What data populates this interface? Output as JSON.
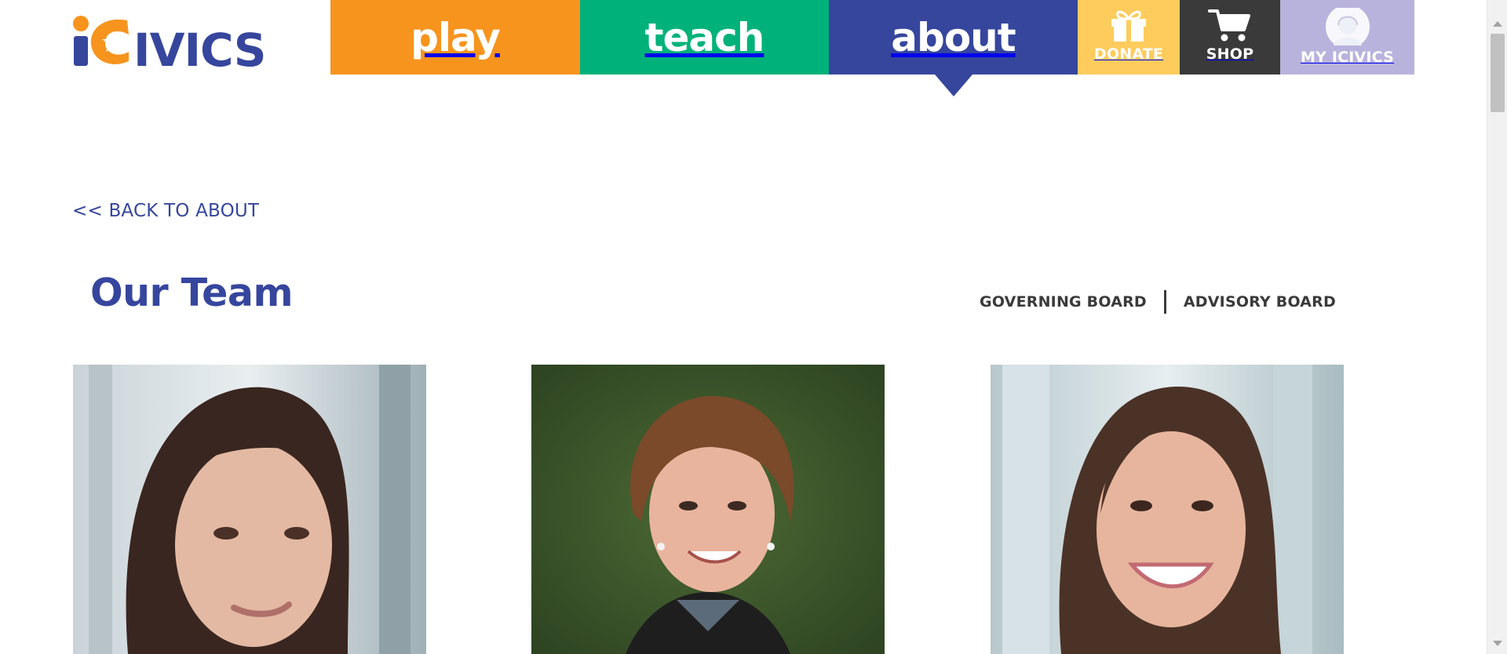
{
  "header": {
    "logo_alt": "iCivics",
    "nav": {
      "play": "play",
      "teach": "teach",
      "about": "about",
      "donate": "DONATE",
      "shop": "SHOP",
      "my_icivics": "MY ICIVICS"
    },
    "active_nav": "about",
    "colors": {
      "play": "#f7941d",
      "teach": "#00b27a",
      "about": "#36469d",
      "donate": "#fdcc5c",
      "shop": "#3a3a3a",
      "my_icivics": "#b8b3dc"
    },
    "icons": {
      "donate": "gift-icon",
      "shop": "cart-icon",
      "my_icivics": "user-avatar-icon"
    }
  },
  "main": {
    "back_link": "<< BACK TO ABOUT",
    "title": "Our Team",
    "board_tabs": [
      "GOVERNING BOARD",
      "ADVISORY BOARD"
    ]
  }
}
